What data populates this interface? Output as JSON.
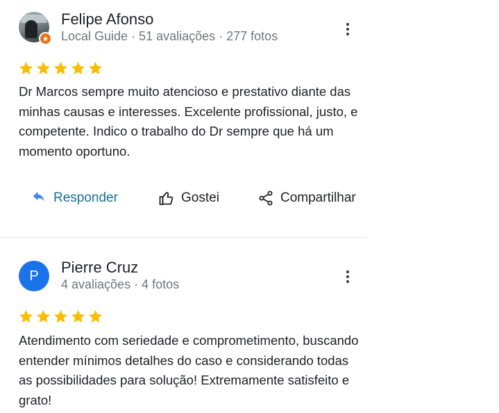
{
  "colors": {
    "star": "#fbbc04",
    "reply_accent": "#1a73e8",
    "avatar_blue": "#1a73e8",
    "guide_badge": "#e8711a",
    "meta_text": "#70757a"
  },
  "reviews": [
    {
      "author": "Felipe Afonso",
      "meta": "Local Guide · 51 avaliações · 277 fotos",
      "avatar_type": "photo",
      "badge_icon": "local-guide-star-icon",
      "rating": 5,
      "text": "Dr Marcos sempre muito atencioso e prestativo diante das minhas causas e interesses. Excelente profissional, justo, e competente. Indico o trabalho do Dr sempre que há um momento oportuno.",
      "actions": {
        "reply": {
          "label": "Responder",
          "icon": "reply-arrow-icon"
        },
        "like": {
          "label": "Gostei",
          "icon": "thumbs-up-icon"
        },
        "share": {
          "label": "Compartilhar",
          "icon": "share-icon"
        }
      }
    },
    {
      "author": "Pierre Cruz",
      "meta": "4 avaliações · 4 fotos",
      "avatar_type": "initial",
      "avatar_initial": "P",
      "rating": 5,
      "text": "Atendimento com seriedade e comprometimento, buscando entender mínimos detalhes do caso e considerando todas as possibilidades para solução! Extremamente satisfeito e grato!"
    }
  ]
}
